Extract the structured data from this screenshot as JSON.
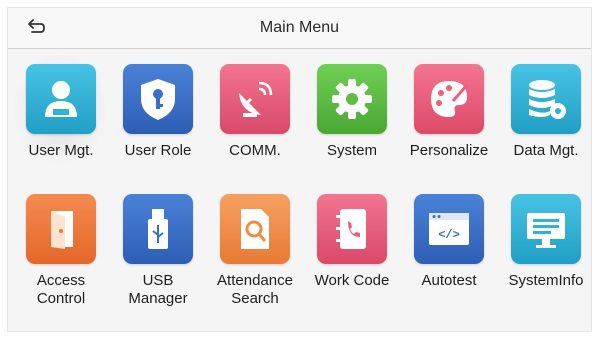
{
  "header": {
    "title": "Main Menu",
    "back_icon": "back-arrow-icon"
  },
  "menu": {
    "selected_index": 0,
    "items": [
      {
        "id": "user-mgt",
        "label": "User Mgt.",
        "icon": "user-icon",
        "color": "#2fb4d6"
      },
      {
        "id": "user-role",
        "label": "User Role",
        "icon": "shield-key-icon",
        "color": "#3a6fc7"
      },
      {
        "id": "comm",
        "label": "COMM.",
        "icon": "satellite-dish-icon",
        "color": "#ea5f7c"
      },
      {
        "id": "system",
        "label": "System",
        "icon": "gear-icon",
        "color": "#5ebd45"
      },
      {
        "id": "personalize",
        "label": "Personalize",
        "icon": "palette-icon",
        "color": "#ee5f79"
      },
      {
        "id": "data-mgt",
        "label": "Data Mgt.",
        "icon": "database-gear-icon",
        "color": "#2fb4d6"
      },
      {
        "id": "access-control",
        "label": "Access\nControl",
        "icon": "door-icon",
        "color": "#f07a3c"
      },
      {
        "id": "usb-manager",
        "label": "USB\nManager",
        "icon": "usb-icon",
        "color": "#3a6fc7"
      },
      {
        "id": "attendance-search",
        "label": "Attendance\nSearch",
        "icon": "search-document-icon",
        "color": "#f08d45"
      },
      {
        "id": "work-code",
        "label": "Work Code",
        "icon": "phone-book-icon",
        "color": "#ea5f7c"
      },
      {
        "id": "autotest",
        "label": "Autotest",
        "icon": "code-window-icon",
        "color": "#3a6fc7"
      },
      {
        "id": "systeminfo",
        "label": "SystemInfo",
        "icon": "monitor-icon",
        "color": "#2fb4d6"
      }
    ]
  }
}
